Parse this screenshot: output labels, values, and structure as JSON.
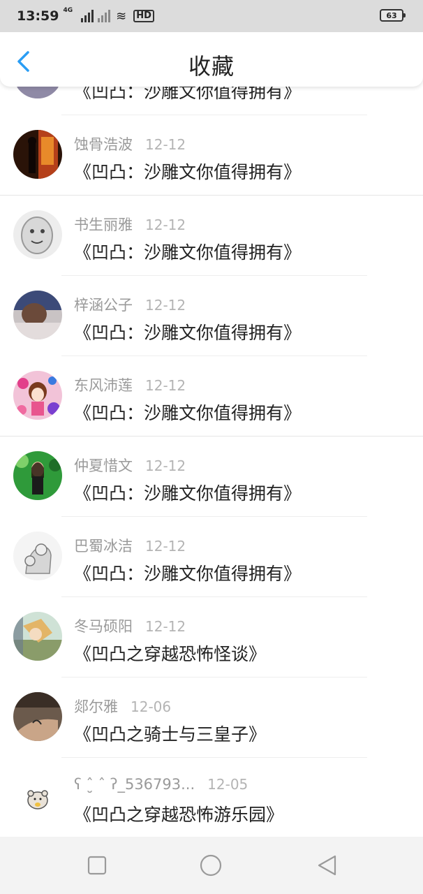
{
  "status_bar": {
    "time": "13:59",
    "network_label": "4G",
    "hd_label": "HD",
    "battery": "63"
  },
  "header": {
    "title": "收藏",
    "back_icon": "chevron-left-icon",
    "accent_color": "#2a9df4"
  },
  "favorites": [
    {
      "author": "",
      "date": "",
      "work": "《凹凸：沙雕文你值得拥有》",
      "avatar": "avatar-partial"
    },
    {
      "author": "蚀骨浩波",
      "date": "12-12",
      "work": "《凹凸：沙雕文你值得拥有》",
      "avatar": "dark-figure-avatar"
    },
    {
      "author": "书生丽雅",
      "date": "12-12",
      "work": "《凹凸：沙雕文你值得拥有》",
      "avatar": "sketch-face-avatar"
    },
    {
      "author": "梓涵公子",
      "date": "12-12",
      "work": "《凹凸：沙雕文你值得拥有》",
      "avatar": "photo-avatar"
    },
    {
      "author": "东风沛莲",
      "date": "12-12",
      "work": "《凹凸：沙雕文你值得拥有》",
      "avatar": "anime-girl-avatar"
    },
    {
      "author": "仲夏惜文",
      "date": "12-12",
      "work": "《凹凸：沙雕文你值得拥有》",
      "avatar": "green-portrait-avatar"
    },
    {
      "author": "巴蜀冰洁",
      "date": "12-12",
      "work": "《凹凸：沙雕文你值得拥有》",
      "avatar": "manga-sketch-avatar"
    },
    {
      "author": "冬马硕阳",
      "date": "12-12",
      "work": "《凹凸之穿越恐怖怪谈》",
      "avatar": "anime-boy-avatar"
    },
    {
      "author": "郯尔雅",
      "date": "12-06",
      "work": "《凹凸之骑士与三皇子》",
      "avatar": "tattoo-arm-avatar"
    },
    {
      "author": "ʕ ˆ̮ ˆ ʔ_536793...",
      "date": "12-05",
      "work": "《凹凸之穿越恐怖游乐园》",
      "avatar": "hamster-avatar"
    }
  ],
  "navbar": {
    "icons": [
      "square-recent-icon",
      "circle-home-icon",
      "triangle-back-icon"
    ]
  }
}
